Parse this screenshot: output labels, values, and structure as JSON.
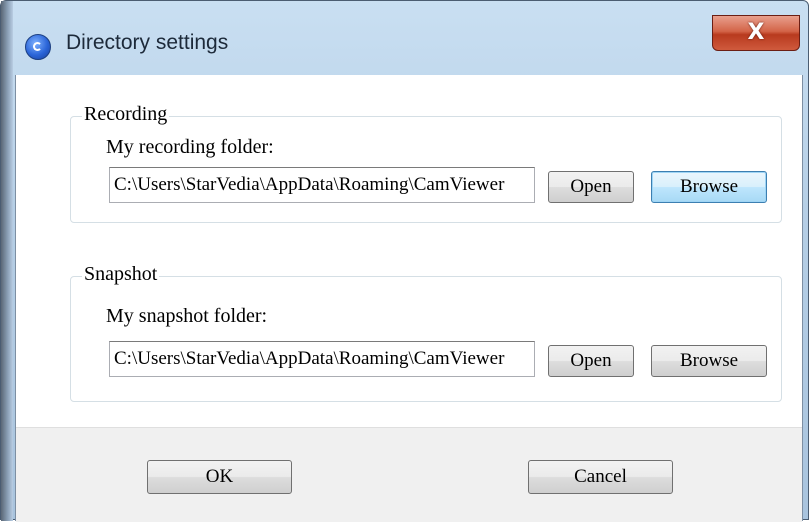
{
  "window": {
    "title": "Directory settings",
    "close_label": "X"
  },
  "recording": {
    "group_label": "Recording",
    "field_label": "My recording folder:",
    "path_value": "C:\\Users\\StarVedia\\AppData\\Roaming\\CamViewer",
    "open_label": "Open",
    "browse_label": "Browse"
  },
  "snapshot": {
    "group_label": "Snapshot",
    "field_label": "My snapshot folder:",
    "path_value": "C:\\Users\\StarVedia\\AppData\\Roaming\\CamViewer",
    "open_label": "Open",
    "browse_label": "Browse"
  },
  "footer": {
    "ok_label": "OK",
    "cancel_label": "Cancel"
  }
}
